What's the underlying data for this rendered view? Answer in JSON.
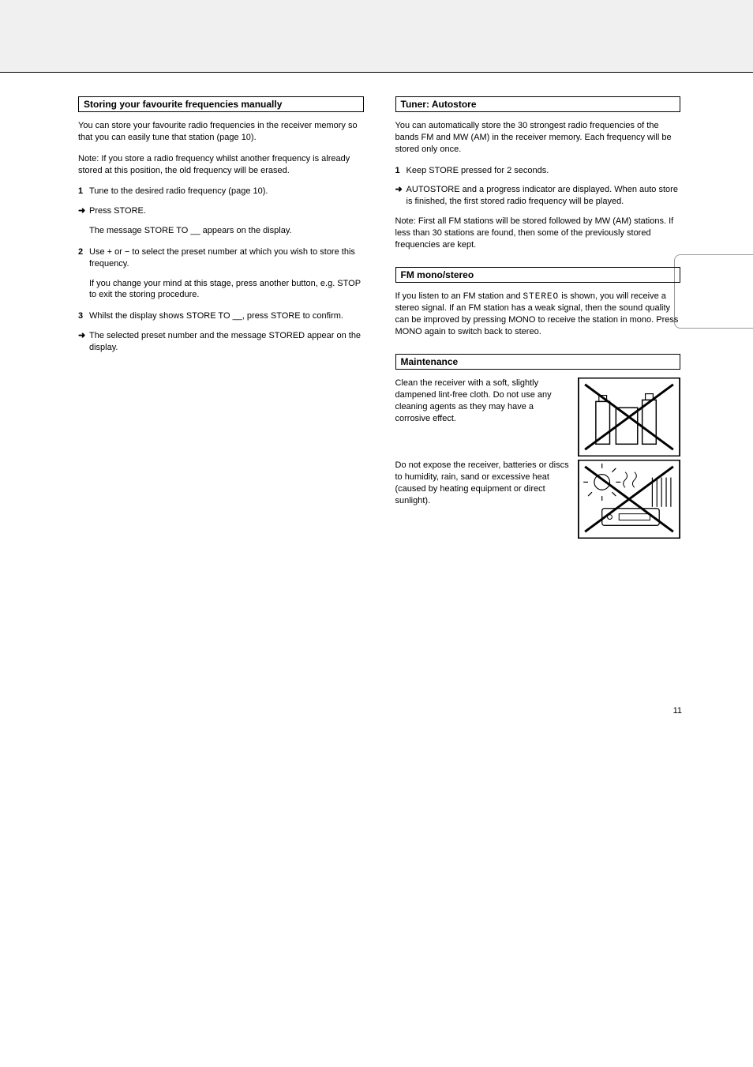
{
  "sections": {
    "manualStore": {
      "title": "Storing your favourite frequencies manually",
      "intro": "You can store your favourite radio frequencies in the receiver memory so that you can easily tune that station (page 10).",
      "note": "Note: If you store a radio frequency whilst another frequency is already stored at this position, the old frequency will be erased.",
      "step1a": "Tune to the desired radio frequency (page 10).",
      "step1b": "Press STORE.",
      "step1c": "The message STORE TO __ appears on the display.",
      "step2a": "Use + or − to select the preset number at which you wish to store this frequency.",
      "step2b": "If you change your mind at this stage, press another button, e.g. STOP to exit the storing procedure.",
      "step3a": "Whilst the display shows STORE TO __, press STORE to confirm.",
      "step3b": "The selected preset number and the message STORED appear on the display."
    },
    "autoStore": {
      "title": "Tuner: Autostore",
      "intro": "You can automatically store the 30 strongest radio frequencies of the bands FM and MW (AM) in the receiver memory. Each frequency will be stored only once.",
      "step1a": "Keep STORE pressed for 2 seconds.",
      "step1b": "AUTOSTORE and a progress indicator are displayed. When auto store is finished, the first stored radio frequency will be played.",
      "footnote": "Note: First all FM stations will be stored followed by MW (AM) stations. If less than 30 stations are found, then some of the previously stored frequencies are kept."
    },
    "fmMono": {
      "title": "FM mono/stereo",
      "p": "If you listen to an FM station and STEREO is shown, you will receive a stereo signal. If an FM station has a weak signal, then the sound quality can be improved by pressing MONO to receive the station in mono. Press MONO again to switch back to stereo.",
      "stereoWord": "STEREO"
    },
    "maintenance": {
      "title": "Maintenance",
      "p1": "Clean the receiver with a soft, slightly dampened lint-free cloth. Do not use any cleaning agents as they may have a corrosive effect.",
      "p2": "Do not expose the receiver, batteries or discs to humidity, rain, sand or excessive heat (caused by heating equipment or direct sunlight)."
    }
  },
  "labels": {
    "num1": "1",
    "num2": "2",
    "num3": "3",
    "arrow": "➜",
    "plus": "+",
    "minus": "−"
  },
  "pageNum": "11"
}
